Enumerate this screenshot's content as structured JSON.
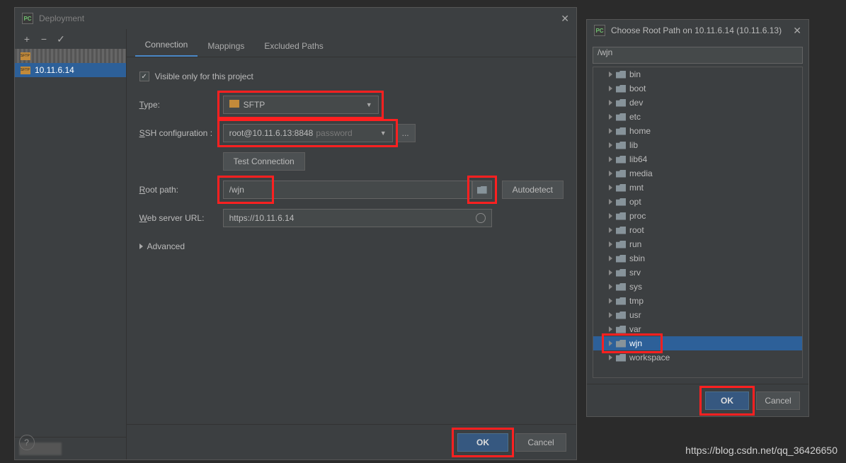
{
  "main": {
    "title": "Deployment",
    "tabs": [
      "Connection",
      "Mappings",
      "Excluded Paths"
    ],
    "active_tab": 0,
    "visible_only_label": "Visible only for this project",
    "visible_only_checked": true,
    "type_label": "Type:",
    "type_value": "SFTP",
    "ssh_label": "SSH configuration",
    "ssh_value": "root@10.11.6.13:8848",
    "ssh_authkind": "password",
    "ssh_more": "...",
    "test_conn": "Test Connection",
    "root_label": "Root path:",
    "root_value": "/wjn",
    "autodetect": "Autodetect",
    "web_label": "Web server URL:",
    "web_value": "https://10.11.6.14",
    "advanced": "Advanced",
    "ok": "OK",
    "cancel": "Cancel",
    "help": "?"
  },
  "side": {
    "items": [
      {
        "label": "",
        "blurred": true
      },
      {
        "label": "10.11.6.14",
        "selected": true
      }
    ]
  },
  "choose": {
    "title": "Choose Root Path on 10.11.6.14 (10.11.6.13)",
    "path": "/wjn",
    "nodes": [
      "bin",
      "boot",
      "dev",
      "etc",
      "home",
      "lib",
      "lib64",
      "media",
      "mnt",
      "opt",
      "proc",
      "root",
      "run",
      "sbin",
      "srv",
      "sys",
      "tmp",
      "usr",
      "var",
      "wjn",
      "workspace"
    ],
    "selected": "wjn",
    "ok": "OK",
    "cancel": "Cancel"
  },
  "watermark": "https://blog.csdn.net/qq_36426650"
}
